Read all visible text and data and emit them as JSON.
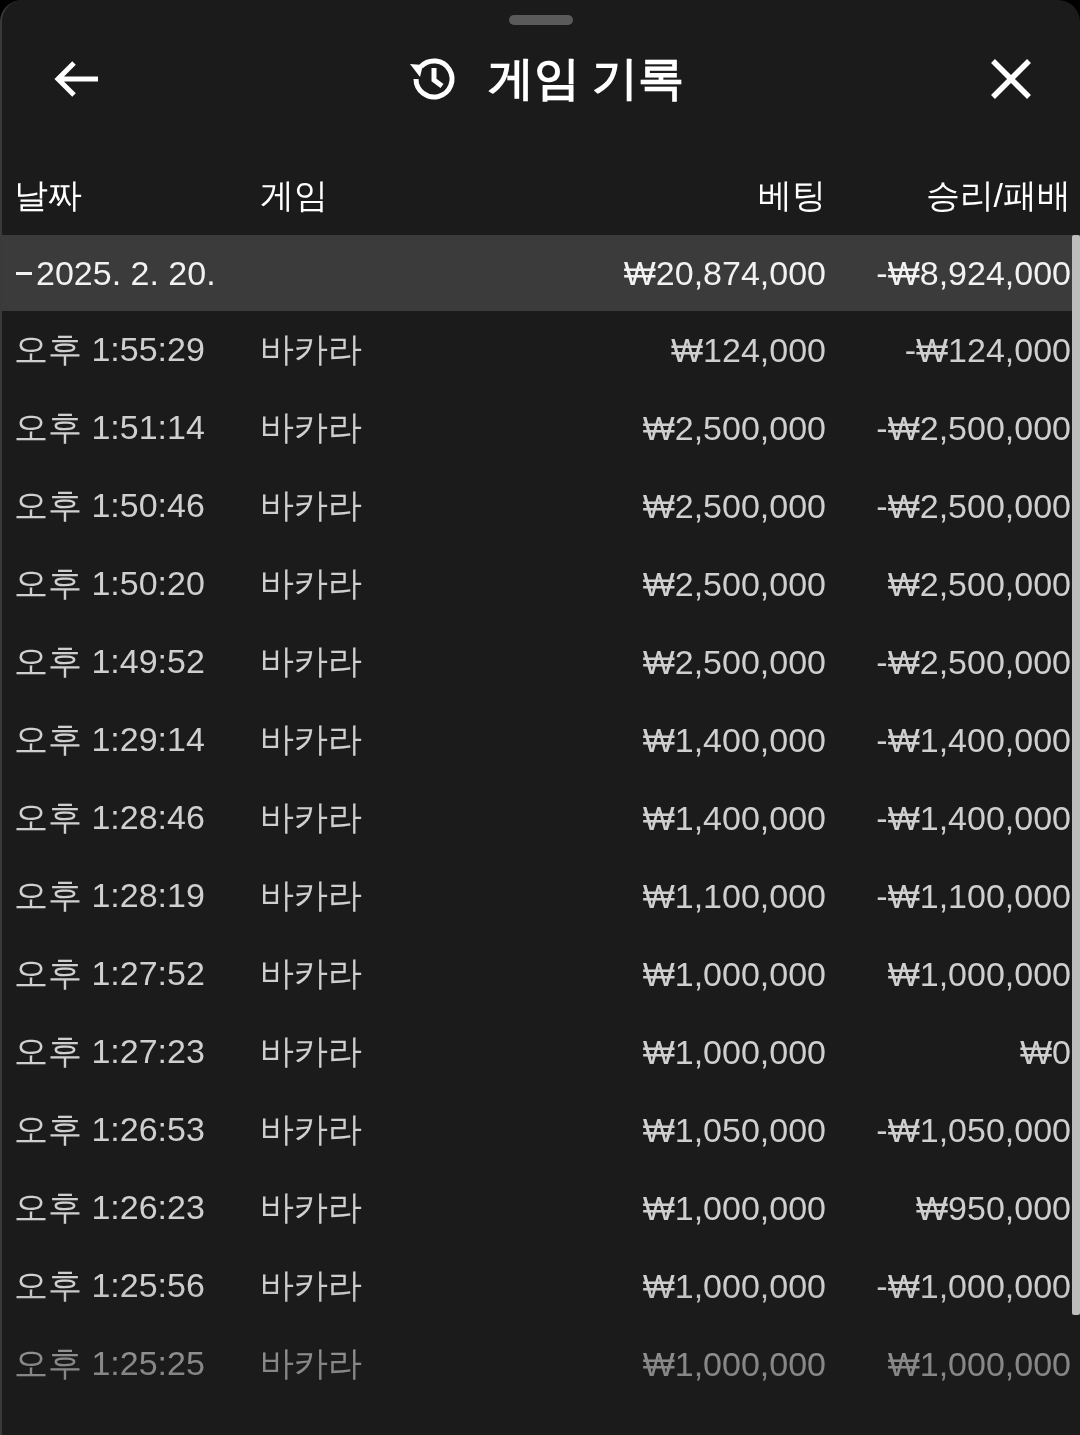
{
  "header": {
    "title": "게임 기록"
  },
  "table": {
    "columns": [
      "날짜",
      "게임",
      "베팅",
      "승리/패배"
    ],
    "groups": [
      {
        "date": "2025. 2. 20.",
        "expanded": true,
        "bet": "₩20,874,000",
        "result": "-₩8,924,000",
        "rows": [
          {
            "time": "오후 1:55:29",
            "game": "바카라",
            "bet": "₩124,000",
            "result": "-₩124,000"
          },
          {
            "time": "오후 1:51:14",
            "game": "바카라",
            "bet": "₩2,500,000",
            "result": "-₩2,500,000"
          },
          {
            "time": "오후 1:50:46",
            "game": "바카라",
            "bet": "₩2,500,000",
            "result": "-₩2,500,000"
          },
          {
            "time": "오후 1:50:20",
            "game": "바카라",
            "bet": "₩2,500,000",
            "result": "₩2,500,000"
          },
          {
            "time": "오후 1:49:52",
            "game": "바카라",
            "bet": "₩2,500,000",
            "result": "-₩2,500,000"
          },
          {
            "time": "오후 1:29:14",
            "game": "바카라",
            "bet": "₩1,400,000",
            "result": "-₩1,400,000"
          },
          {
            "time": "오후 1:28:46",
            "game": "바카라",
            "bet": "₩1,400,000",
            "result": "-₩1,400,000"
          },
          {
            "time": "오후 1:28:19",
            "game": "바카라",
            "bet": "₩1,100,000",
            "result": "-₩1,100,000"
          },
          {
            "time": "오후 1:27:52",
            "game": "바카라",
            "bet": "₩1,000,000",
            "result": "₩1,000,000"
          },
          {
            "time": "오후 1:27:23",
            "game": "바카라",
            "bet": "₩1,000,000",
            "result": "₩0"
          },
          {
            "time": "오후 1:26:53",
            "game": "바카라",
            "bet": "₩1,050,000",
            "result": "-₩1,050,000"
          },
          {
            "time": "오후 1:26:23",
            "game": "바카라",
            "bet": "₩1,000,000",
            "result": "₩950,000"
          },
          {
            "time": "오후 1:25:56",
            "game": "바카라",
            "bet": "₩1,000,000",
            "result": "-₩1,000,000"
          },
          {
            "time": "오후 1:25:25",
            "game": "바카라",
            "bet": "₩1,000,000",
            "result": "₩1,000,000"
          }
        ]
      }
    ]
  }
}
